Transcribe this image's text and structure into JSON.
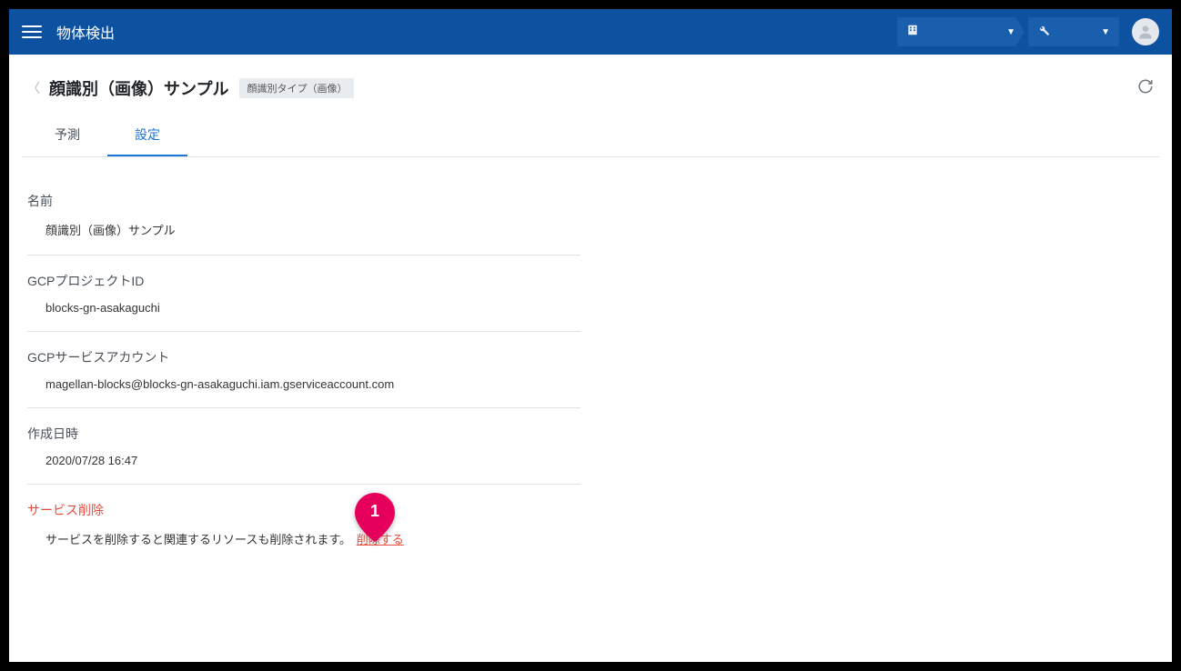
{
  "header": {
    "app_title": "物体検出"
  },
  "breadcrumb": {
    "page_title": "顔識別（画像）サンプル",
    "type_badge": "顔識別タイプ（画像）"
  },
  "tabs": {
    "predict": "予測",
    "settings": "設定"
  },
  "fields": {
    "name_label": "名前",
    "name_value": "顔識別（画像）サンプル",
    "project_label": "GCPプロジェクトID",
    "project_value": "blocks-gn-asakaguchi",
    "sa_label": "GCPサービスアカウント",
    "sa_value": "magellan-blocks@blocks-gn-asakaguchi.iam.gserviceaccount.com",
    "created_label": "作成日時",
    "created_value": "2020/07/28 16:47",
    "delete_label": "サービス削除",
    "delete_desc": "サービスを削除すると関連するリソースも削除されます。",
    "delete_link": "削除する"
  },
  "callouts": {
    "marker1": "1"
  }
}
